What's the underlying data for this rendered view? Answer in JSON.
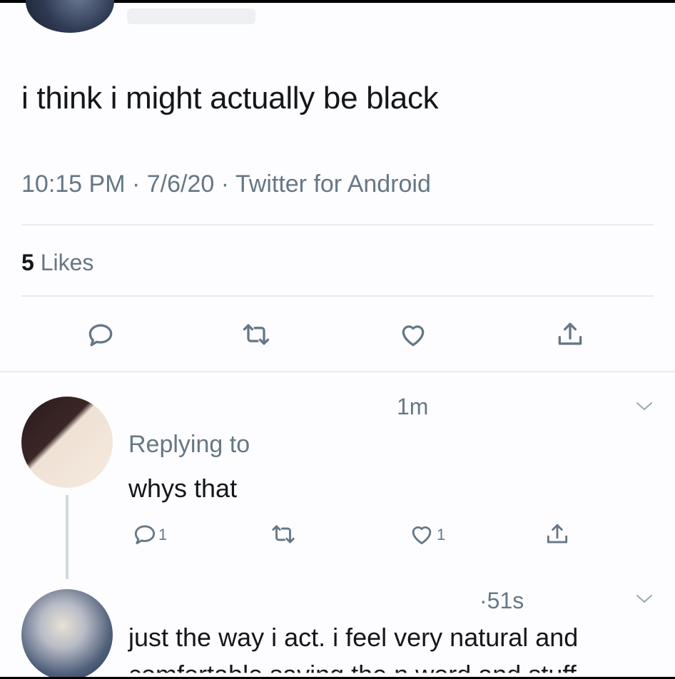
{
  "tweet": {
    "text": "i think i might actually be black",
    "meta": "10:15 PM · 7/6/20 · Twitter for Android",
    "likes_count": "5",
    "likes_label": "Likes"
  },
  "replies": [
    {
      "time": "1m",
      "replying_label": "Replying to",
      "text": "whys that",
      "reply_count": "1",
      "like_count": "1"
    },
    {
      "time": "·51s",
      "text_line1": "just the way i act. i feel very natural and",
      "text_line2": "comfortable saying the n word and stuff"
    }
  ],
  "icons": {
    "reply": "reply-icon",
    "retweet": "retweet-icon",
    "like": "heart-icon",
    "share": "share-icon",
    "more": "chevron-down-icon"
  },
  "colors": {
    "text": "#14171a",
    "muted": "#657786",
    "divider": "#e6ecf0",
    "thread": "#cfd9de"
  }
}
